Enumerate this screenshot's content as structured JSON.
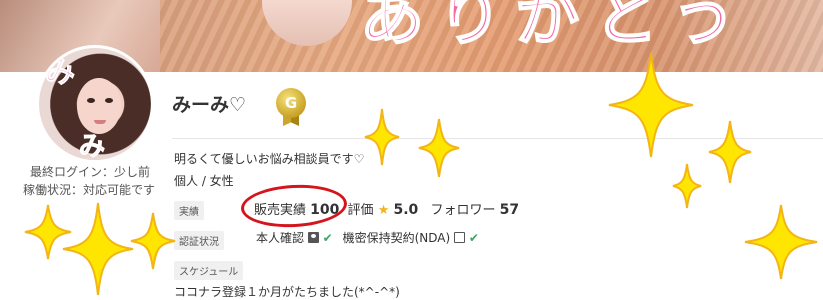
{
  "cover": {
    "decor_text": "ありがとう"
  },
  "profile": {
    "name": "みーみ♡",
    "rank_badge": "G",
    "last_login": "最終ログイン：少し前",
    "work_status": "稼働状況：対応可能です",
    "intro": "明るくて優しいお悩み相談員です♡",
    "type_gender": "個人 /  女性"
  },
  "stats": {
    "label": "実績",
    "sales_label": "販売実績",
    "sales_value": "100",
    "rating_label": "評価",
    "rating_value": "5.0",
    "followers_label": "フォロワー",
    "followers_value": "57"
  },
  "verification": {
    "label": "認証状況",
    "identity": "本人確認",
    "nda": "機密保持契約(NDA)"
  },
  "schedule": {
    "label": "スケジュール",
    "text": "ココナラ登録１か月がたちました(*^-^*)"
  },
  "colors": {
    "sparkle": "#ffe600",
    "sparkle_outline": "#f3b514",
    "annotation_circle": "#d4151c",
    "check": "#3aa564"
  },
  "icons": [
    "rank-medal-icon",
    "star-icon",
    "id-card-icon",
    "lock-icon",
    "check-icon",
    "sparkle-icon"
  ]
}
